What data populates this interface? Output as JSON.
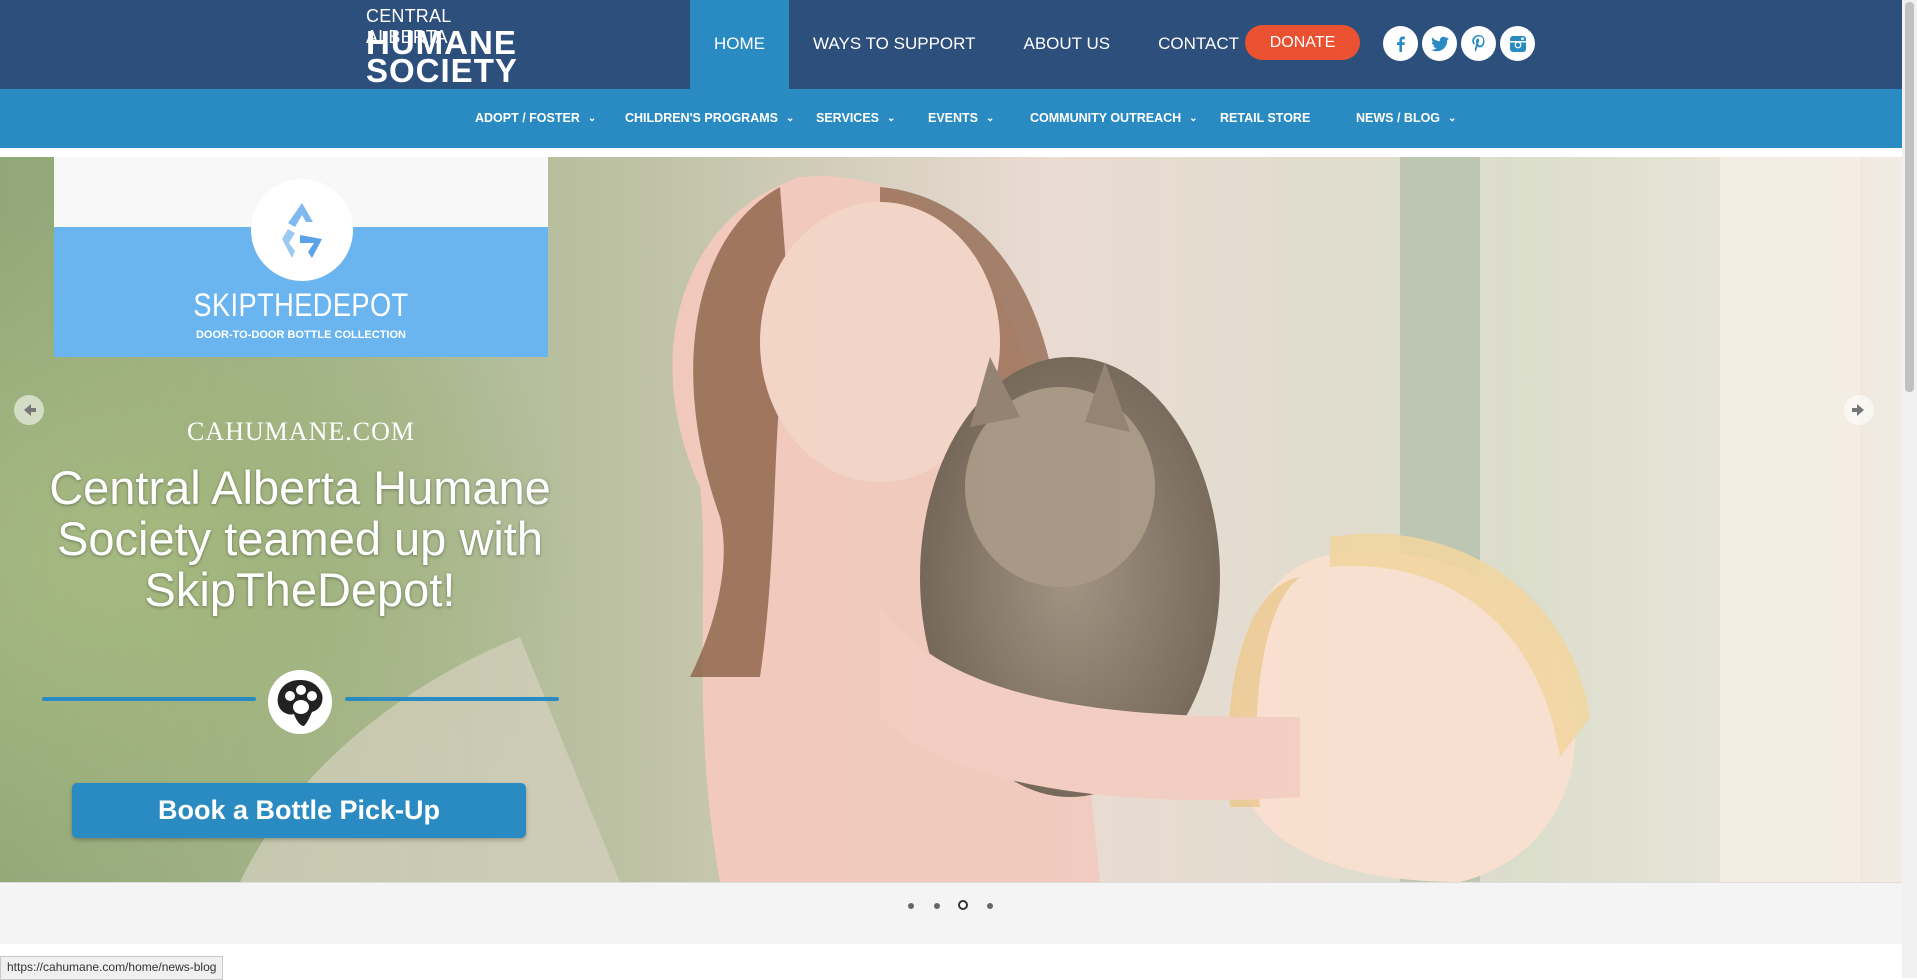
{
  "logo": {
    "line1": "CENTRAL ALBERTA",
    "line2": "HUMANE",
    "line3": "SOCIETY"
  },
  "main_nav": [
    {
      "label": "HOME",
      "active": true
    },
    {
      "label": "WAYS TO SUPPORT"
    },
    {
      "label": "ABOUT US"
    },
    {
      "label": "CONTACT"
    }
  ],
  "donate_label": "DONATE",
  "social_icons": [
    "facebook-icon",
    "twitter-icon",
    "pinterest-icon",
    "instagram-icon"
  ],
  "sub_nav": [
    {
      "label": "ADOPT / FOSTER",
      "dropdown": true
    },
    {
      "label": "CHILDREN'S PROGRAMS",
      "dropdown": true
    },
    {
      "label": "SERVICES",
      "dropdown": true
    },
    {
      "label": "EVENTS",
      "dropdown": true
    },
    {
      "label": "COMMUNITY OUTREACH",
      "dropdown": true
    },
    {
      "label": "RETAIL STORE",
      "dropdown": false
    },
    {
      "label": "NEWS / BLOG",
      "dropdown": true
    }
  ],
  "hero": {
    "brand_name": "SKIPTHEDEPOT",
    "brand_tagline": "DOOR-TO-DOOR BOTTLE COLLECTION",
    "site_url": "CAHUMANE.COM",
    "headline_line1": "Central Alberta Humane",
    "headline_line2": "Society teamed up with",
    "headline_line3": "SkipTheDepot!",
    "cta_label": "Book a Bottle Pick-Up"
  },
  "slider": {
    "slide_count": 4,
    "active_index": 2
  },
  "status_url": "https://cahumane.com/home/news-blog",
  "colors": {
    "topbar": "#2d4f7c",
    "subnav": "#2a8bc3",
    "donate": "#ea5131",
    "skipthedepot_blue": "#6ab4f0"
  }
}
